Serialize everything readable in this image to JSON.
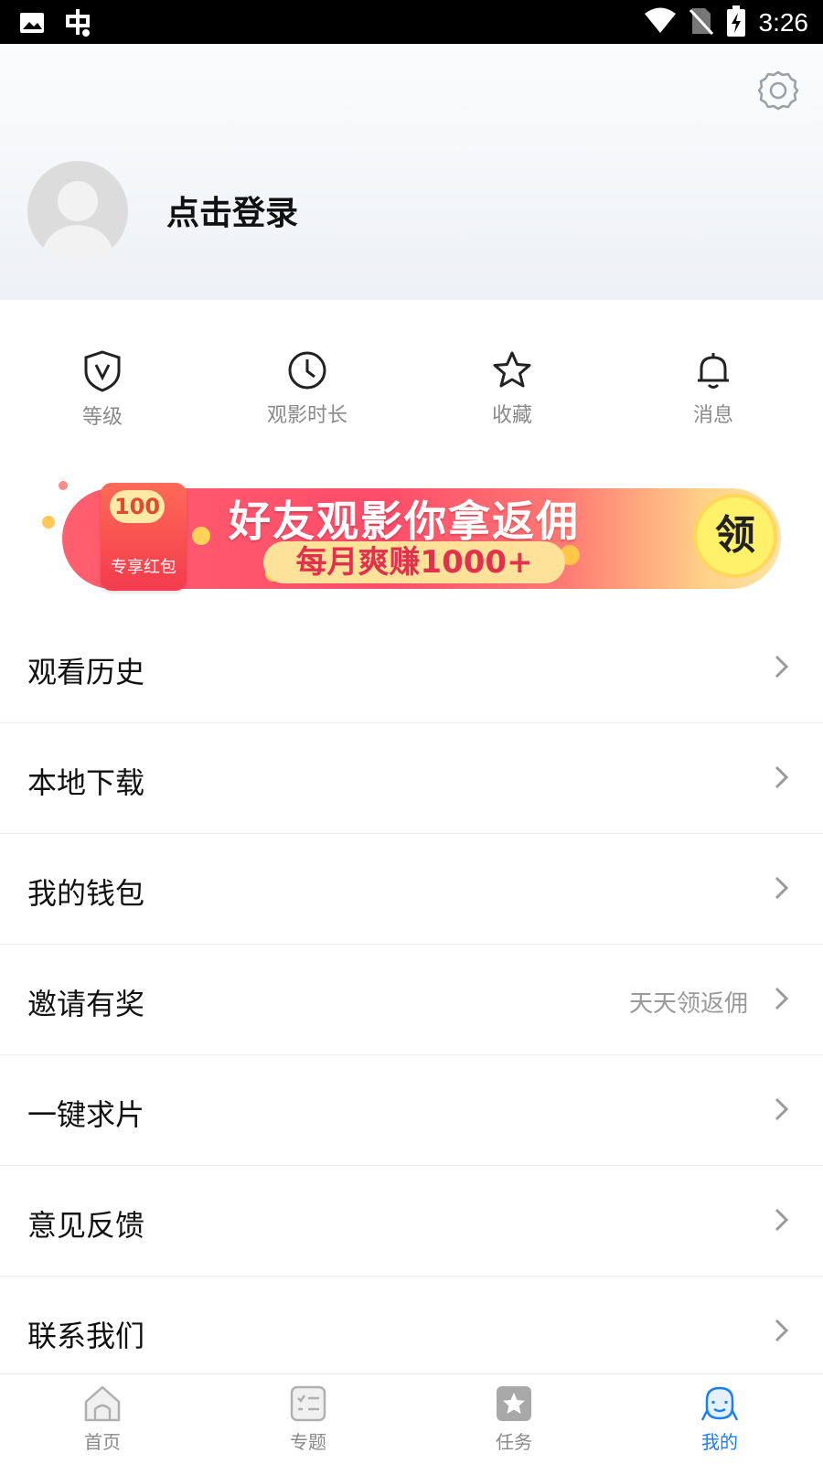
{
  "status_bar": {
    "time": "3:26"
  },
  "header": {
    "login_text": "点击登录"
  },
  "quick_actions": [
    {
      "label": "等级",
      "icon": "shield-v-icon"
    },
    {
      "label": "观影时长",
      "icon": "clock-icon"
    },
    {
      "label": "收藏",
      "icon": "star-icon"
    },
    {
      "label": "消息",
      "icon": "bell-icon"
    }
  ],
  "banner": {
    "title": "好友观影你拿返佣",
    "subtitle": "每月爽赚1000+",
    "envelope_amount": "100",
    "envelope_label": "专享红包",
    "cta": "领"
  },
  "menu": [
    {
      "label": "观看历史",
      "sub": ""
    },
    {
      "label": "本地下载",
      "sub": ""
    },
    {
      "label": "我的钱包",
      "sub": ""
    },
    {
      "label": "邀请有奖",
      "sub": "天天领返佣"
    },
    {
      "label": "一键求片",
      "sub": ""
    },
    {
      "label": "意见反馈",
      "sub": ""
    },
    {
      "label": "联系我们",
      "sub": ""
    }
  ],
  "tabs": [
    {
      "label": "首页",
      "icon": "home-icon",
      "active": false
    },
    {
      "label": "专题",
      "icon": "list-icon",
      "active": false
    },
    {
      "label": "任务",
      "icon": "task-icon",
      "active": false
    },
    {
      "label": "我的",
      "icon": "profile-icon",
      "active": true
    }
  ],
  "colors": {
    "accent": "#1a7ef5",
    "banner_red": "#ff4d6a",
    "muted": "#8a8a8a"
  }
}
